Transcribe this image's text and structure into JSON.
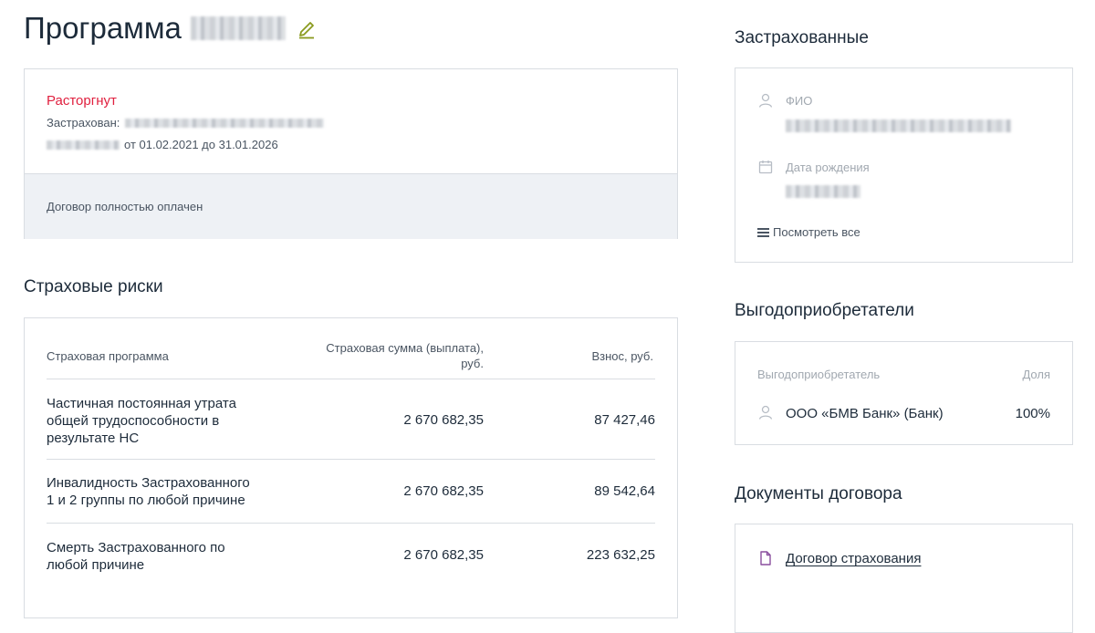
{
  "header": {
    "title": "Программа"
  },
  "policy": {
    "status": "Расторгнут",
    "insured_label": "Застрахован:",
    "period": "от 01.02.2021 до 31.01.2026",
    "payment_status": "Договор полностью оплачен"
  },
  "risks": {
    "title": "Страховые риски",
    "columns": {
      "program": "Страховая программа",
      "sum_line1": "Страховая сумма (выплата),",
      "sum_line2": "руб.",
      "fee": "Взнос, руб."
    },
    "rows": [
      {
        "name_lines": [
          "Частичная постоянная утрата",
          "общей трудоспособности в",
          "результате НС"
        ],
        "sum": "2 670 682,35",
        "fee": "87 427,46"
      },
      {
        "name_lines": [
          "Инвалидность Застрахованного",
          "1 и 2 группы по любой причине"
        ],
        "sum": "2 670 682,35",
        "fee": "89 542,64"
      },
      {
        "name_lines": [
          "Смерть Застрахованного по",
          "любой причине"
        ],
        "sum": "2 670 682,35",
        "fee": "223 632,25"
      }
    ]
  },
  "insured": {
    "title": "Застрахованные",
    "fio_label": "ФИО",
    "dob_label": "Дата рождения",
    "view_all": "Посмотреть все",
    "icons": {
      "person": "person-icon",
      "calendar": "calendar-icon",
      "menu": "menu-icon"
    }
  },
  "beneficiaries": {
    "title": "Выгодоприобретатели",
    "col_name": "Выгодоприобретатель",
    "col_share": "Доля",
    "items": [
      {
        "name": "ООО «БМВ Банк» (Банк)",
        "share": "100%"
      }
    ]
  },
  "documents": {
    "title": "Документы договора",
    "items": [
      {
        "label": "Договор страхования"
      }
    ]
  },
  "colors": {
    "status_terminated": "#e0203f",
    "edit_icon": "#8a9a1e",
    "doc_icon": "#8a4f9e",
    "band_bg": "#eef1f5"
  }
}
